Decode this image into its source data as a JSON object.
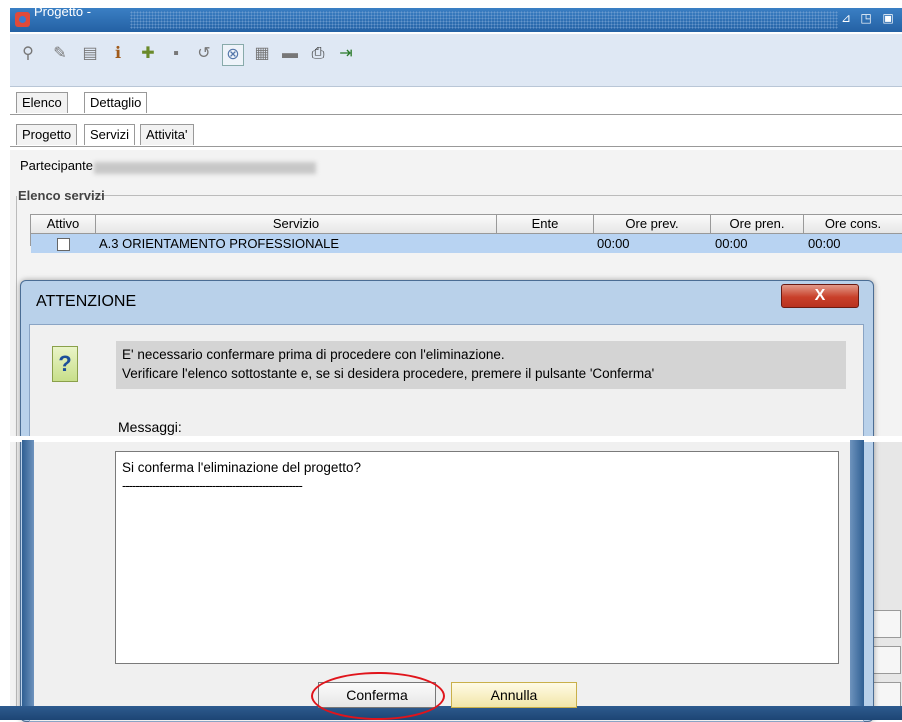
{
  "window": {
    "title": "Progetto -",
    "controls": [
      "restore-icon",
      "maximize-icon",
      "extra-icon"
    ]
  },
  "toolbar": {
    "icons": [
      "search-icon",
      "edit-icon",
      "document-icon",
      "info-icon",
      "new-icon",
      "save-icon",
      "undo-icon",
      "delete-icon",
      "grid-icon",
      "folder-icon",
      "print-icon",
      "exit-icon"
    ]
  },
  "tabs_level1": [
    "Elenco",
    "Dettaglio"
  ],
  "tabs_level2": [
    "Progetto",
    "Servizi",
    "Attivita'"
  ],
  "participant": {
    "label": "Partecipante"
  },
  "services": {
    "legend": "Elenco servizi",
    "columns": [
      "Attivo",
      "Servizio",
      "Ente",
      "Ore prev.",
      "Ore pren.",
      "Ore cons."
    ],
    "rows": [
      {
        "attivo": false,
        "servizio": "A.3 ORIENTAMENTO PROFESSIONALE",
        "ente": "",
        "ore_prev": "00:00",
        "ore_pren": "00:00",
        "ore_cons": "00:00"
      }
    ]
  },
  "dialog": {
    "title": "ATTENZIONE",
    "close": "X",
    "icon": "?",
    "message_line1": "E' necessario confermare prima di procedere con l'eliminazione.",
    "message_line2": "Verificare l'elenco sottostante e, se si desidera procedere, premere il pulsante 'Conferma'",
    "messages_label": "Messaggi:",
    "messages_text_line1": "Si conferma l'eliminazione del progetto?",
    "messages_text_line2": "------------------------------------------------------",
    "confirm_label": "Conferma",
    "cancel_label": "Annulla"
  },
  "colors": {
    "selected_row": "#b8d3f2",
    "dialog_frame": "#b9d1ea",
    "close_button": "#c9402a",
    "highlight_ring": "#e0141b"
  }
}
